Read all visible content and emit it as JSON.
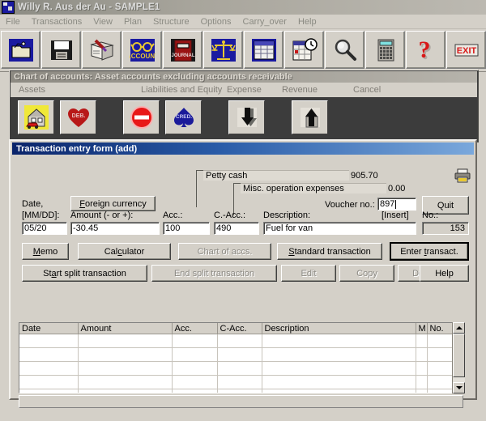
{
  "window": {
    "title": "Willy R. Aus der Au - SAMPLE1",
    "app_icon": "ledger-icon"
  },
  "menubar": {
    "items": [
      {
        "label": "File"
      },
      {
        "label": "Transactions"
      },
      {
        "label": "View"
      },
      {
        "label": "Plan"
      },
      {
        "label": "Structure"
      },
      {
        "label": "Options"
      },
      {
        "label": "Carry_over"
      },
      {
        "label": "Help"
      }
    ]
  },
  "toolbar": {
    "buttons": [
      {
        "icon": "open-folder-icon",
        "name": "open-file-button"
      },
      {
        "icon": "floppy-save-icon",
        "name": "save-file-button"
      },
      {
        "icon": "write-book-icon",
        "name": "journal-entry-button"
      },
      {
        "icon": "account-glasses-icon",
        "name": "accounts-button"
      },
      {
        "icon": "journal-book-icon",
        "name": "journal-button"
      },
      {
        "icon": "balance-scales-icon",
        "name": "balance-sheet-button"
      },
      {
        "icon": "spreadsheet-icon",
        "name": "spreadsheet-button"
      },
      {
        "icon": "calendar-clock-icon",
        "name": "calendar-button"
      },
      {
        "icon": "magnifier-icon",
        "name": "search-button"
      },
      {
        "icon": "calculator-icon",
        "name": "calculator-button"
      },
      {
        "icon": "question-mark-icon",
        "name": "help-button"
      },
      {
        "icon": "exit-icon",
        "name": "exit-button",
        "label": "EXIT"
      }
    ]
  },
  "chart_of_accounts": {
    "title": "Chart of accounts: Asset accounts excluding accounts receivable",
    "menu": [
      {
        "label": "Assets"
      },
      {
        "label": "Liabilities and Equity"
      },
      {
        "label": "Expense"
      },
      {
        "label": "Revenue"
      },
      {
        "label": "Cancel"
      }
    ],
    "buttons": [
      {
        "icon": "house-car-icon",
        "name": "assets-button"
      },
      {
        "icon": "heart-debit-icon",
        "name": "debit-button",
        "label": "DEB."
      },
      {
        "icon": "no-entry-icon",
        "name": "cancel-button"
      },
      {
        "icon": "spade-credit-icon",
        "name": "credit-button",
        "label": "CRED."
      },
      {
        "icon": "arrow-down-icon",
        "name": "move-down-button"
      },
      {
        "icon": "arrow-up-icon",
        "name": "move-up-button"
      }
    ]
  },
  "transaction_form": {
    "title": "Transaction entry form (add)",
    "debit_readout": {
      "account_name": "Petty cash",
      "balance": "905.70"
    },
    "credit_readout": {
      "account_name": "Misc. operation expenses",
      "balance": "0.00"
    },
    "print_icon": "printer-icon",
    "foreign_currency_button": "Foreign currency",
    "quit_button": "Quit",
    "voucher_label": "Voucher no.:",
    "voucher_value": "897",
    "fields": [
      {
        "name": "date-field",
        "label_line1": "Date,",
        "label_line2": "[MM/DD]:",
        "value": "05/20"
      },
      {
        "name": "amount-field",
        "label_line1": "",
        "label_line2": "Amount (- or +):",
        "value": "-30.45"
      },
      {
        "name": "account-field",
        "label_line1": "",
        "label_line2": "Acc.:",
        "value": "100"
      },
      {
        "name": "contra-account-field",
        "label_line1": "",
        "label_line2": "C.-Acc.:",
        "value": "490"
      },
      {
        "name": "description-field",
        "label_line1": "",
        "label_line2": "Description:",
        "value": "Fuel for van",
        "hint": "[Insert]"
      },
      {
        "name": "number-field",
        "label_line1": "",
        "label_line2": "No.:",
        "value": "153"
      }
    ],
    "buttons_row1": [
      {
        "label": "Memo",
        "name": "memo-button",
        "enabled": true,
        "default": false
      },
      {
        "label": "Calculator",
        "name": "calculator-button",
        "enabled": true,
        "default": false
      },
      {
        "label": "Chart of accs.",
        "name": "chart-of-accounts-button",
        "enabled": false,
        "default": false
      },
      {
        "label": "Standard transaction",
        "name": "standard-transaction-button",
        "enabled": true,
        "default": false
      },
      {
        "label": "Enter transact.",
        "name": "enter-transaction-button",
        "enabled": true,
        "default": true
      }
    ],
    "buttons_row2": [
      {
        "label": "Start split transaction",
        "name": "start-split-transaction-button",
        "enabled": true,
        "default": false
      },
      {
        "label": "End split transaction",
        "name": "end-split-transaction-button",
        "enabled": false,
        "default": false
      },
      {
        "label": "Edit",
        "name": "edit-button",
        "enabled": false,
        "default": false
      },
      {
        "label": "Copy",
        "name": "copy-button",
        "enabled": false,
        "default": false
      },
      {
        "label": "Delete",
        "name": "delete-button",
        "enabled": false,
        "default": false
      },
      {
        "label": "Help",
        "name": "help-button",
        "enabled": true,
        "default": false
      }
    ],
    "grid": {
      "columns": [
        "Date",
        "Amount",
        "Acc.",
        "C-Acc.",
        "Description",
        "M",
        "No."
      ],
      "rows": [
        [
          "",
          "",
          "",
          "",
          "",
          "",
          ""
        ],
        [
          "",
          "",
          "",
          "",
          "",
          "",
          ""
        ],
        [
          "",
          "",
          "",
          "",
          "",
          "",
          ""
        ],
        [
          "",
          "",
          "",
          "",
          "",
          "",
          ""
        ],
        [
          "",
          "",
          "",
          "",
          "",
          "",
          ""
        ]
      ]
    }
  },
  "colors": {
    "face": "#d4d0c8",
    "title_active": "#0a246a",
    "title_inactive": "#8d8a82",
    "mdi_background": "#3c3c3c",
    "accent_red": "#d81818",
    "accent_blue": "#1a1aa0"
  }
}
